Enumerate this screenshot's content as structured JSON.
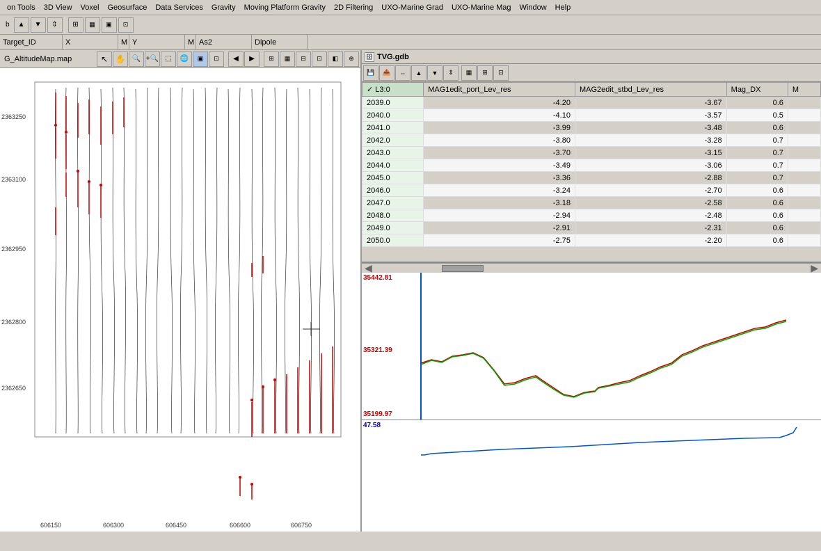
{
  "menubar": {
    "items": [
      "on Tools",
      "3D View",
      "Voxel",
      "Geosurface",
      "Data Services",
      "Gravity",
      "Moving Platform Gravity",
      "2D Filtering",
      "UXO-Marine Grad",
      "UXO-Marine Mag",
      "Window",
      "Help"
    ]
  },
  "toolbar1": {
    "buttons": [
      "↑",
      "↓",
      "↕",
      "⊞",
      "⊟",
      "◫",
      "⊡"
    ]
  },
  "table_header": {
    "columns": [
      "Target_ID",
      "X",
      "Y",
      "As2",
      "Dipole"
    ]
  },
  "map": {
    "filename": "G_AltitudeMap.map",
    "x_labels": [
      "606150",
      "606300",
      "606450",
      "606600",
      "606750"
    ],
    "y_labels": [
      "2363250",
      "2363100",
      "2362950",
      "2362800",
      "2362650"
    ]
  },
  "db_window": {
    "title": "TVG.gdb"
  },
  "table": {
    "columns": [
      "L3:0",
      "MAG1edit_port_Lev_res",
      "MAG2edit_stbd_Lev_res",
      "Mag_DX",
      "M"
    ],
    "rows": [
      {
        "l3": "2039.0",
        "mag1": "-4.20",
        "mag2": "-3.67",
        "dx": "0.6"
      },
      {
        "l3": "2040.0",
        "mag1": "-4.10",
        "mag2": "-3.57",
        "dx": "0.5"
      },
      {
        "l3": "2041.0",
        "mag1": "-3.99",
        "mag2": "-3.48",
        "dx": "0.6"
      },
      {
        "l3": "2042.0",
        "mag1": "-3.80",
        "mag2": "-3.28",
        "dx": "0.7"
      },
      {
        "l3": "2043.0",
        "mag1": "-3.70",
        "mag2": "-3.15",
        "dx": "0.7"
      },
      {
        "l3": "2044.0",
        "mag1": "-3.49",
        "mag2": "-3.06",
        "dx": "0.7"
      },
      {
        "l3": "2045.0",
        "mag1": "-3.36",
        "mag2": "-2.88",
        "dx": "0.7"
      },
      {
        "l3": "2046.0",
        "mag1": "-3.24",
        "mag2": "-2.70",
        "dx": "0.6"
      },
      {
        "l3": "2047.0",
        "mag1": "-3.18",
        "mag2": "-2.58",
        "dx": "0.6"
      },
      {
        "l3": "2048.0",
        "mag1": "-2.94",
        "mag2": "-2.48",
        "dx": "0.6"
      },
      {
        "l3": "2049.0",
        "mag1": "-2.91",
        "mag2": "-2.31",
        "dx": "0.6"
      },
      {
        "l3": "2050.0",
        "mag1": "-2.75",
        "mag2": "-2.20",
        "dx": "0.6"
      }
    ]
  },
  "chart1": {
    "y_max": "35442.81",
    "y_mid": "35321.39",
    "y_min": "35199.97"
  },
  "chart2": {
    "y_top": "47.58"
  }
}
